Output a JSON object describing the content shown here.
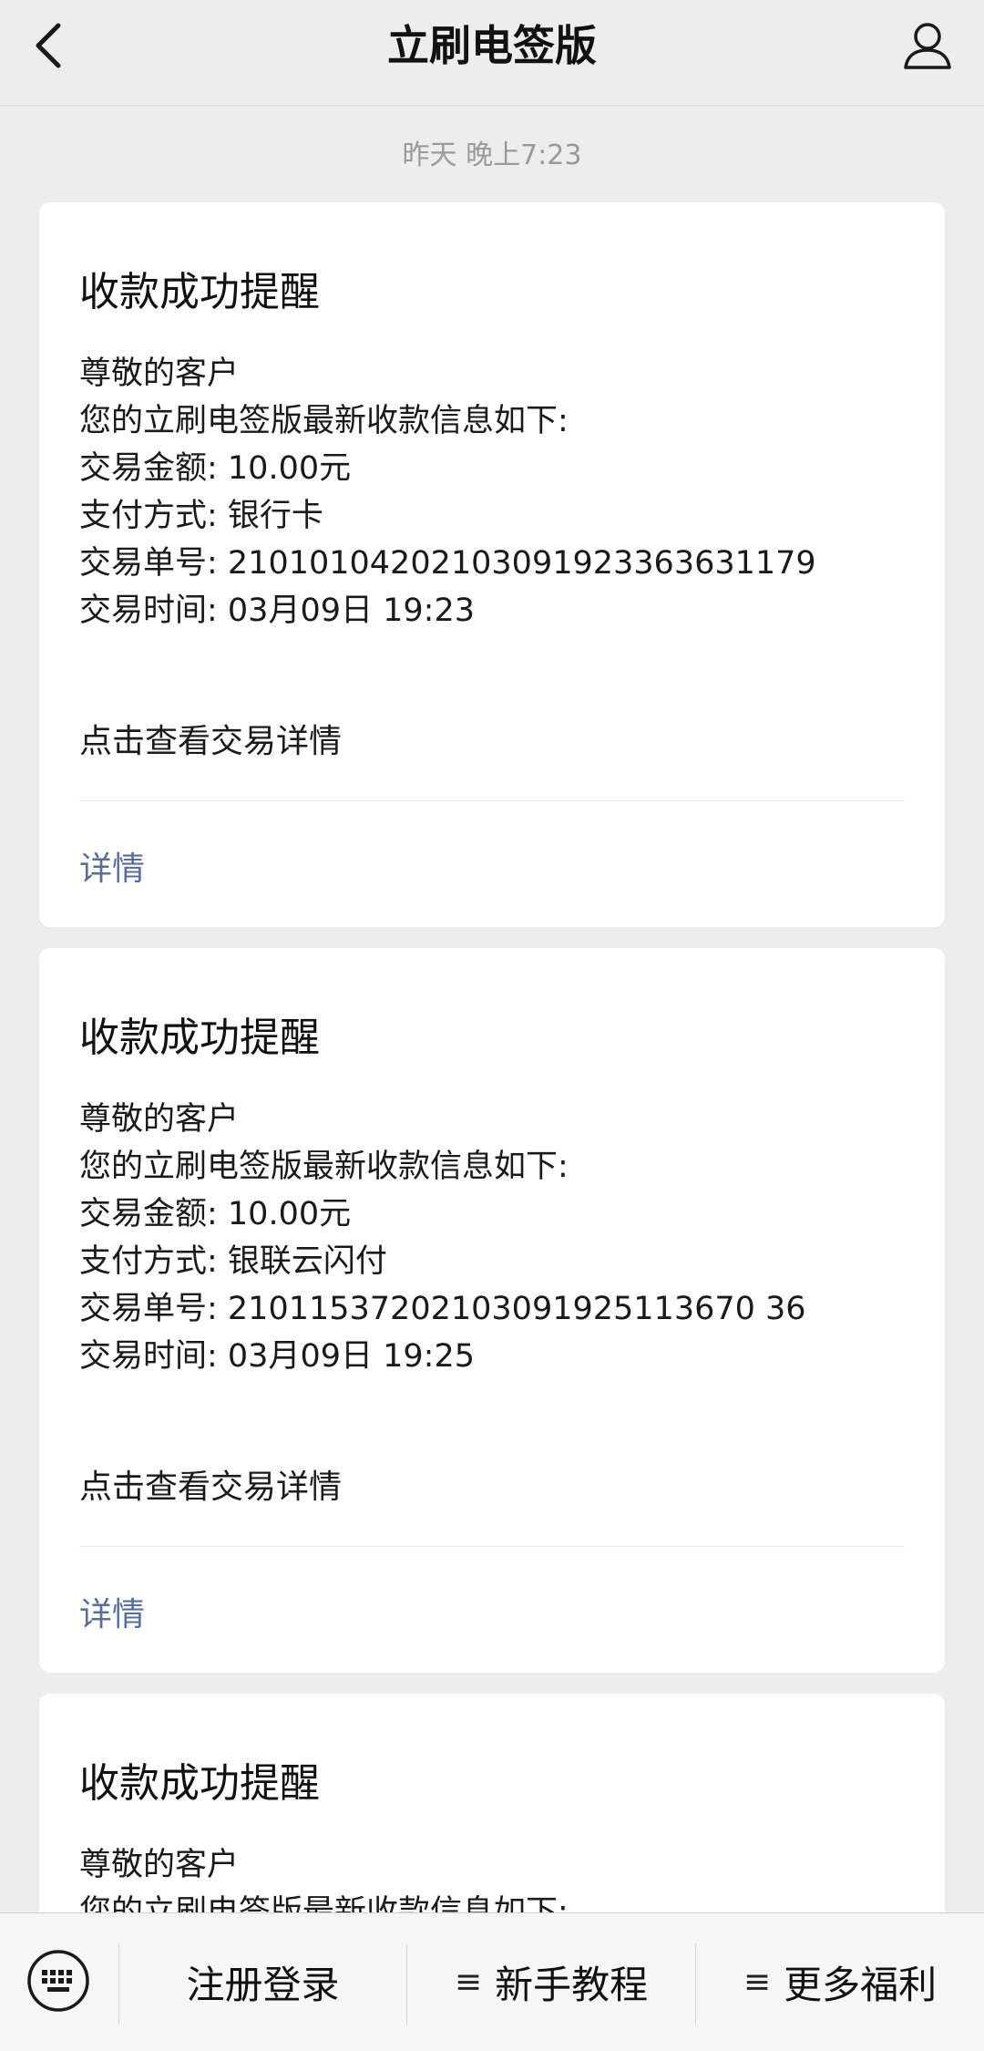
{
  "header": {
    "title": "立刷电签版"
  },
  "timestamp": "昨天 晚上7:23",
  "cards": [
    {
      "title": "收款成功提醒",
      "lines": [
        "尊敬的客户",
        "您的立刷电签版最新收款信息如下:",
        "交易金额: 10.00元",
        "支付方式: 银行卡",
        "交易单号: 21010104202103091923363631179",
        "交易时间: 03月09日 19:23"
      ],
      "link_text": "点击查看交易详情",
      "detail_label": "详情"
    },
    {
      "title": "收款成功提醒",
      "lines": [
        "尊敬的客户",
        "您的立刷电签版最新收款信息如下:",
        "交易金额: 10.00元",
        "支付方式: 银联云闪付",
        "交易单号: 21011537202103091925113670 36",
        "交易时间: 03月09日 19:25"
      ],
      "link_text": "点击查看交易详情",
      "detail_label": "详情"
    },
    {
      "title": "收款成功提醒",
      "lines": [
        "尊敬的客户",
        "您的立刷电签版最新收款信息如下:"
      ]
    }
  ],
  "bottom_menu": {
    "items": [
      {
        "label": "注册登录",
        "glyph": ""
      },
      {
        "label": "新手教程",
        "glyph": "≡"
      },
      {
        "label": "更多福利",
        "glyph": "≡"
      }
    ]
  },
  "icons": {
    "back": "back-chevron-icon",
    "profile": "user-profile-icon",
    "keyboard": "keyboard-icon",
    "menu": "menu-lines-icon"
  },
  "colors": {
    "background": "#ededed",
    "card": "#ffffff",
    "link_blue": "#5a6f98",
    "muted_text": "#9a9a9a"
  }
}
